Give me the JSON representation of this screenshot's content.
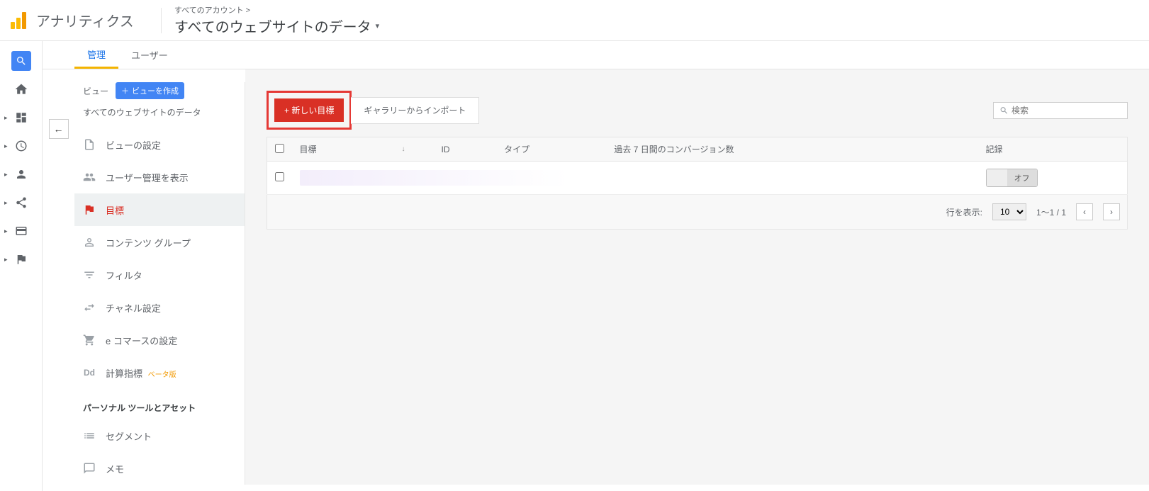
{
  "header": {
    "product": "アナリティクス",
    "breadcrumb_top": "すべてのアカウント >",
    "breadcrumb_title": "すべてのウェブサイトのデータ"
  },
  "tabs": {
    "admin": "管理",
    "user": "ユーザー"
  },
  "view": {
    "label": "ビュー",
    "create_btn": "ビューを作成",
    "subtitle": "すべてのウェブサイトのデータ"
  },
  "side": {
    "view_settings": "ビューの設定",
    "user_mgmt": "ユーザー管理を表示",
    "goals": "目標",
    "content_groups": "コンテンツ グループ",
    "filters": "フィルタ",
    "channel": "チャネル設定",
    "ecommerce": "e コマースの設定",
    "calc_metrics": "計算指標",
    "beta": "ベータ版",
    "section_tools": "パーソナル ツールとアセット",
    "segments": "セグメント",
    "notes": "メモ"
  },
  "actions": {
    "new_goal": "+ 新しい目標",
    "import_gallery": "ギャラリーからインポート",
    "search_placeholder": "検索"
  },
  "table": {
    "col_goal": "目標",
    "col_id": "ID",
    "col_type": "タイプ",
    "col_conv": "過去 7 日間のコンバージョン数",
    "col_record": "記録",
    "toggle_off": "オフ"
  },
  "pager": {
    "rows_label": "行を表示:",
    "rows_value": "10",
    "range": "1～1 / 1"
  }
}
